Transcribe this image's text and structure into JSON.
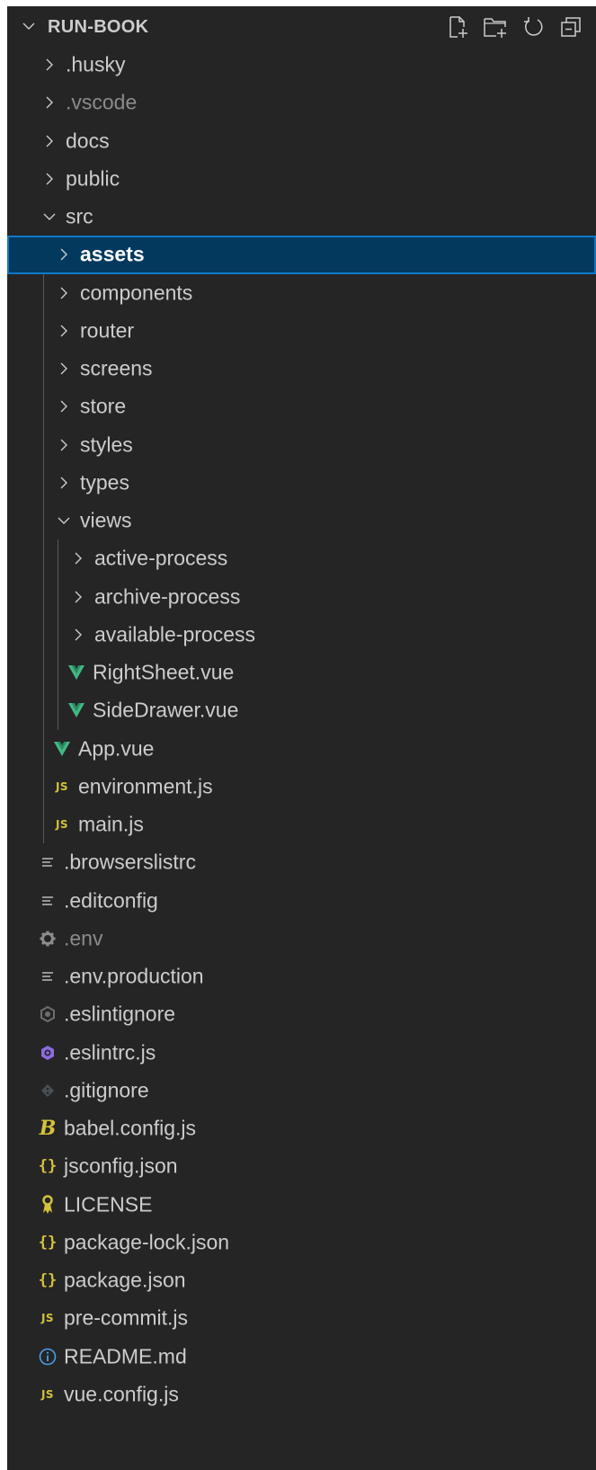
{
  "explorer": {
    "title": "RUN-BOOK",
    "actions": [
      {
        "name": "new-file-icon"
      },
      {
        "name": "new-folder-icon"
      },
      {
        "name": "refresh-icon"
      },
      {
        "name": "collapse-all-icon"
      }
    ]
  },
  "tree": [
    {
      "label": ".husky",
      "kind": "folder",
      "expanded": false,
      "depth": 1,
      "dim": false
    },
    {
      "label": ".vscode",
      "kind": "folder",
      "expanded": false,
      "depth": 1,
      "dim": true
    },
    {
      "label": "docs",
      "kind": "folder",
      "expanded": false,
      "depth": 1,
      "dim": false
    },
    {
      "label": "public",
      "kind": "folder",
      "expanded": false,
      "depth": 1,
      "dim": false
    },
    {
      "label": "src",
      "kind": "folder",
      "expanded": true,
      "depth": 1,
      "dim": false
    },
    {
      "label": "assets",
      "kind": "folder",
      "expanded": false,
      "depth": 2,
      "dim": false,
      "selected": true
    },
    {
      "label": "components",
      "kind": "folder",
      "expanded": false,
      "depth": 2,
      "dim": false
    },
    {
      "label": "router",
      "kind": "folder",
      "expanded": false,
      "depth": 2,
      "dim": false
    },
    {
      "label": "screens",
      "kind": "folder",
      "expanded": false,
      "depth": 2,
      "dim": false
    },
    {
      "label": "store",
      "kind": "folder",
      "expanded": false,
      "depth": 2,
      "dim": false
    },
    {
      "label": "styles",
      "kind": "folder",
      "expanded": false,
      "depth": 2,
      "dim": false
    },
    {
      "label": "types",
      "kind": "folder",
      "expanded": false,
      "depth": 2,
      "dim": false
    },
    {
      "label": "views",
      "kind": "folder",
      "expanded": true,
      "depth": 2,
      "dim": false
    },
    {
      "label": "active-process",
      "kind": "folder",
      "expanded": false,
      "depth": 3,
      "dim": false
    },
    {
      "label": "archive-process",
      "kind": "folder",
      "expanded": false,
      "depth": 3,
      "dim": false
    },
    {
      "label": "available-process",
      "kind": "folder",
      "expanded": false,
      "depth": 3,
      "dim": false
    },
    {
      "label": "RightSheet.vue",
      "kind": "vue",
      "depth": 3,
      "dim": false
    },
    {
      "label": "SideDrawer.vue",
      "kind": "vue",
      "depth": 3,
      "dim": false
    },
    {
      "label": "App.vue",
      "kind": "vue",
      "depth": 2,
      "dim": false
    },
    {
      "label": "environment.js",
      "kind": "js",
      "depth": 2,
      "dim": false
    },
    {
      "label": "main.js",
      "kind": "js",
      "depth": 2,
      "dim": false
    },
    {
      "label": ".browserslistrc",
      "kind": "text",
      "depth": 1,
      "dim": false
    },
    {
      "label": ".editconfig",
      "kind": "text",
      "depth": 1,
      "dim": false
    },
    {
      "label": ".env",
      "kind": "gear",
      "depth": 1,
      "dim": true
    },
    {
      "label": ".env.production",
      "kind": "text",
      "depth": 1,
      "dim": false
    },
    {
      "label": ".eslintignore",
      "kind": "eslint-grey",
      "depth": 1,
      "dim": false
    },
    {
      "label": ".eslintrc.js",
      "kind": "eslint",
      "depth": 1,
      "dim": false
    },
    {
      "label": ".gitignore",
      "kind": "git",
      "depth": 1,
      "dim": false
    },
    {
      "label": "babel.config.js",
      "kind": "babel",
      "depth": 1,
      "dim": false
    },
    {
      "label": "jsconfig.json",
      "kind": "json",
      "depth": 1,
      "dim": false
    },
    {
      "label": "LICENSE",
      "kind": "license",
      "depth": 1,
      "dim": false
    },
    {
      "label": "package-lock.json",
      "kind": "json",
      "depth": 1,
      "dim": false
    },
    {
      "label": "package.json",
      "kind": "json",
      "depth": 1,
      "dim": false
    },
    {
      "label": "pre-commit.js",
      "kind": "js",
      "depth": 1,
      "dim": false
    },
    {
      "label": "README.md",
      "kind": "info",
      "depth": 1,
      "dim": false
    },
    {
      "label": "vue.config.js",
      "kind": "js",
      "depth": 1,
      "dim": false
    }
  ],
  "colors": {
    "background": "#252526",
    "text": "#cccccc",
    "dim_text": "#8b8b8b",
    "selection": "#04395e",
    "selection_border": "#0e78c9",
    "vue_green": "#41b883",
    "js_yellow": "#d4c23a",
    "eslint_purple": "#8e6be0"
  }
}
